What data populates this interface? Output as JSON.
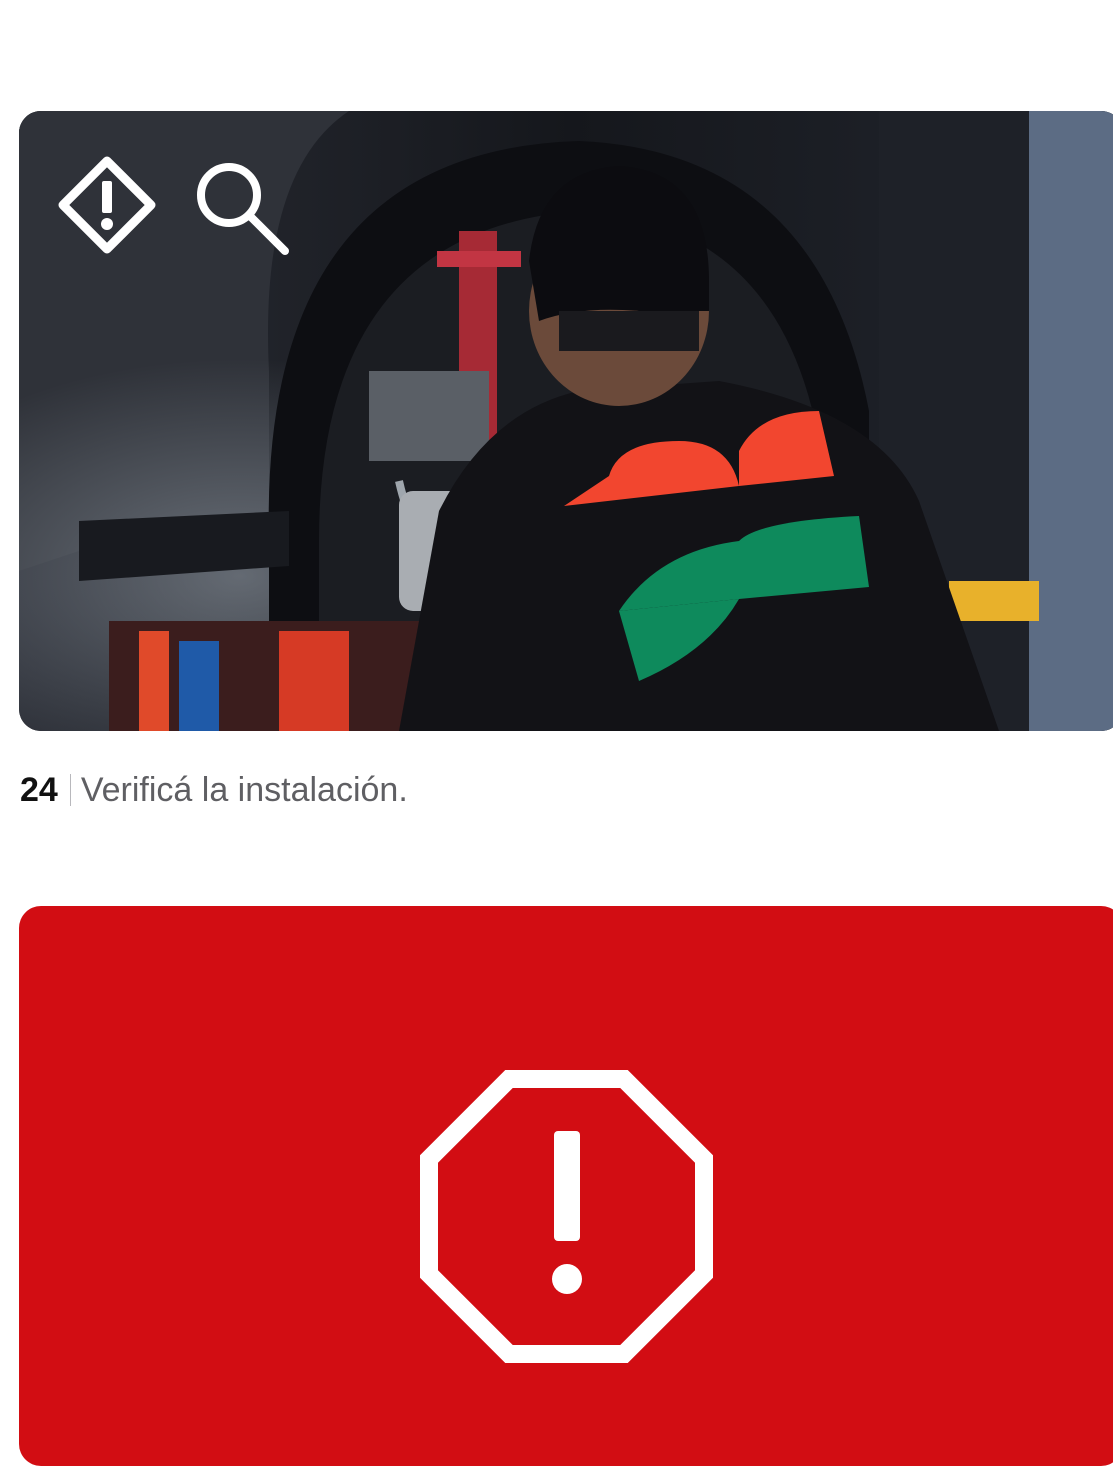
{
  "step": {
    "number": "24",
    "instruction": "Verificá la instalación."
  },
  "icons": {
    "overlay": [
      "warning-diamond-icon",
      "magnifier-icon"
    ],
    "alert": "stop-warning-icon"
  },
  "colors": {
    "alert_background": "#d20d13",
    "icon_white": "#ffffff",
    "logo_red": "#f2462f",
    "logo_green": "#0e8a5c"
  }
}
